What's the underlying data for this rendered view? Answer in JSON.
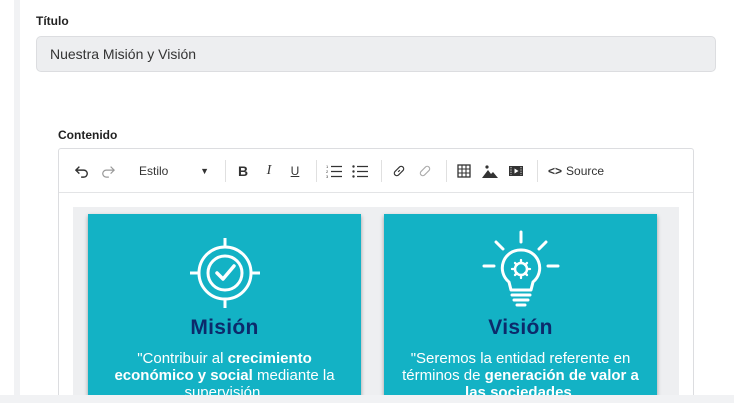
{
  "titulo": {
    "label": "Título",
    "value": "Nuestra Misión y Visión"
  },
  "contenido": {
    "label": "Contenido"
  },
  "toolbar": {
    "undo_icon": "undo-icon",
    "redo_icon": "redo-icon",
    "style_label": "Estilo",
    "bold": "B",
    "italic": "I",
    "underline": "U",
    "source_code": "<>",
    "source_label": "Source"
  },
  "cards": {
    "mision": {
      "title": "Misión",
      "quote_pre": "\"Contribuir al ",
      "quote_bold": "crecimiento económico y social",
      "quote_post": " mediante la supervisión."
    },
    "vision": {
      "title": "Visión",
      "quote_pre": "\"Seremos la entidad referente en términos de ",
      "quote_bold": "generación de valor a las sociedades",
      "quote_post": "."
    }
  },
  "colors": {
    "card_bg": "#13b2c5",
    "card_title": "#0c2a6b"
  }
}
